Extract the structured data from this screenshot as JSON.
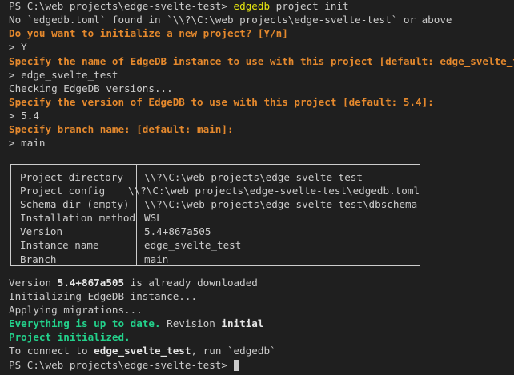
{
  "session": {
    "prompt": "PS C:\\web projects\\edge-svelte-test> ",
    "command_name": "edgedb",
    "command_args": " project init",
    "no_toml": "No `edgedb.toml` found in `\\\\?\\C:\\web projects\\edge-svelte-test` or above",
    "q_init": "Do you want to initialize a new project? [Y/n]",
    "a_init": "> Y",
    "q_name": "Specify the name of EdgeDB instance to use with this project [default: edge_svelte_test]:",
    "a_name": "> edge_svelte_test",
    "checking": "Checking EdgeDB versions...",
    "q_version": "Specify the version of EdgeDB to use with this project [default: 5.4]:",
    "a_version": "> 5.4",
    "q_branch": "Specify branch name: [default: main]:",
    "a_branch": "> main"
  },
  "summary_table": [
    {
      "key": "Project directory",
      "value": "\\\\?\\C:\\web projects\\edge-svelte-test"
    },
    {
      "key": "Project config",
      "value": "\\\\?\\C:\\web projects\\edge-svelte-test\\edgedb.toml"
    },
    {
      "key": "Schema dir (empty)",
      "value": "\\\\?\\C:\\web projects\\edge-svelte-test\\dbschema"
    },
    {
      "key": "Installation method",
      "value": "WSL"
    },
    {
      "key": "Version",
      "value": "5.4+867a505"
    },
    {
      "key": "Instance name",
      "value": "edge_svelte_test"
    },
    {
      "key": "Branch",
      "value": "main"
    }
  ],
  "output": {
    "version_pre": "Version ",
    "version_num": "5.4+867a505",
    "version_post": " is already downloaded",
    "initializing": "Initializing EdgeDB instance...",
    "applying": "Applying migrations...",
    "uptodate": "Everything is up to date.",
    "revision_pre": " Revision ",
    "revision_word": "initial",
    "initialized": "Project initialized.",
    "connect_pre": "To connect to ",
    "connect_name": "edge_svelte_test",
    "connect_post": ", run `edgedb`",
    "final_prompt": "PS C:\\web projects\\edge-svelte-test> "
  }
}
